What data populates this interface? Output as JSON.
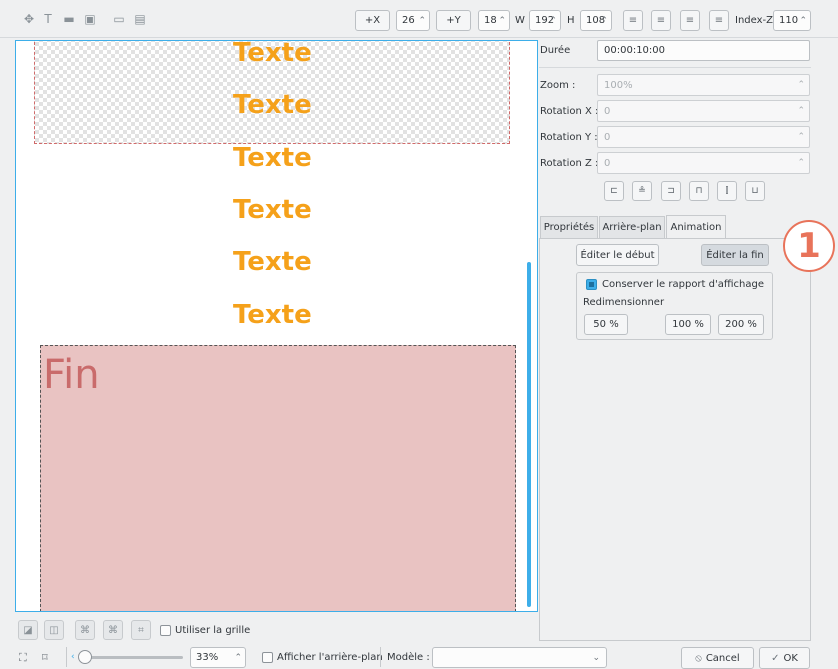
{
  "toolbar": {
    "icons": [
      "move-icon",
      "add-text-icon",
      "add-rect-icon",
      "add-image-icon",
      "open-icon",
      "save-icon"
    ],
    "x_button": "+X",
    "x_value": "26",
    "y_button": "+Y",
    "y_value": "18",
    "w_label": "W",
    "w_value": "192",
    "h_label": "H",
    "h_value": "108",
    "index_z_label": "Index-Z",
    "index_z_value": "110"
  },
  "canvas": {
    "texts": [
      "Texte",
      "Texte",
      "Texte",
      "Texte",
      "Texte",
      "Texte"
    ],
    "fin_label": "Fin"
  },
  "properties": {
    "duree_label": "Durée",
    "duree_value": "00:00:10:00",
    "zoom_label": "Zoom :",
    "zoom_value": "100%",
    "rotx_label": "Rotation X :",
    "rotx_value": "0",
    "roty_label": "Rotation Y :",
    "roty_value": "0",
    "rotz_label": "Rotation Z :",
    "rotz_value": "0"
  },
  "tabs": [
    "Propriétés",
    "Arrière-plan",
    "Animation"
  ],
  "animation": {
    "edit_start": "Éditer le début",
    "edit_end": "Éditer la fin",
    "keep_ratio": "Conserver le rapport d'affichage",
    "resize_label": "Redimensionner",
    "p50": "50 %",
    "p100": "100 %",
    "p200": "200 %"
  },
  "annotation": "1",
  "bottom": {
    "use_grid": "Utiliser la grille",
    "zoom_value": "33%",
    "show_bg": "Afficher l'arrière-plan",
    "template_label": "Modèle :",
    "template_value": "",
    "cancel": "Cancel",
    "ok": "OK"
  },
  "colors": {
    "text_orange": "#f5a11a",
    "fin_bg": "#e9c3c2",
    "fin_text": "#c96b6b",
    "accent": "#3daee9",
    "annotation": "#e8735a"
  }
}
